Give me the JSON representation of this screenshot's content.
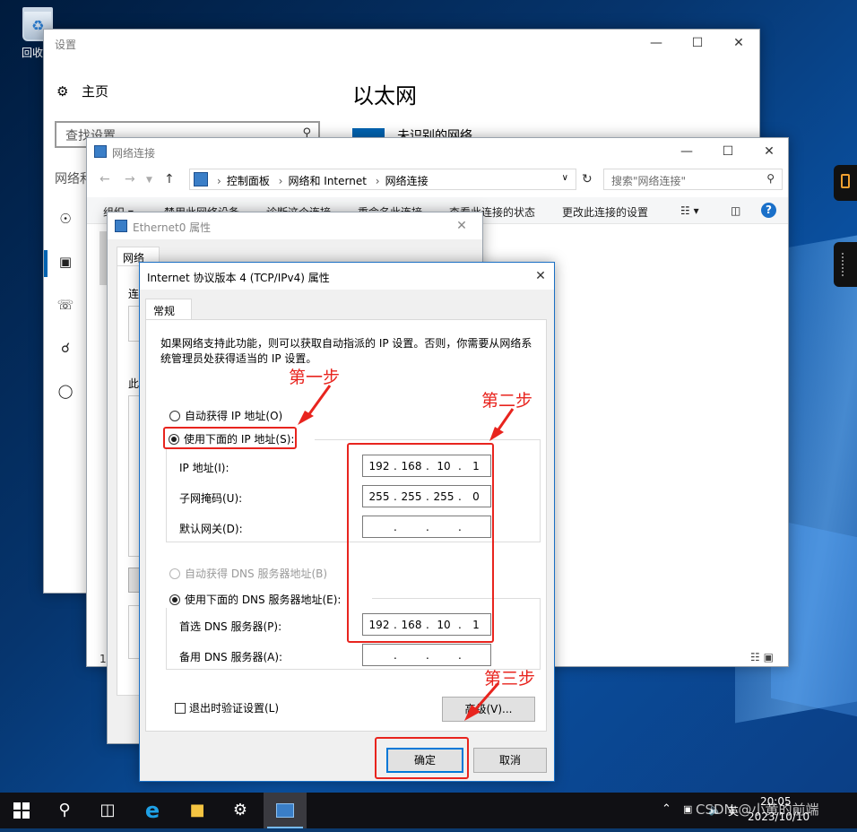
{
  "desktop": {
    "recycle_bin_label": "回收站"
  },
  "settings": {
    "title": "设置",
    "home_label": "主页",
    "search_placeholder": "查找设置",
    "section_label": "网络和",
    "page_title": "以太网",
    "ethernet_label": "未识别的网络"
  },
  "netconn": {
    "title": "网络连接",
    "breadcrumb": [
      "控制面板",
      "网络和 Internet",
      "网络连接"
    ],
    "search_placeholder": "搜索\"网络连接\"",
    "commands": [
      "组织 ▾",
      "禁用此网络设备",
      "诊断这个连接",
      "重命名此连接",
      "查看此连接的状态",
      "更改此连接的设置"
    ],
    "status_count": "1"
  },
  "ethprops": {
    "title": "Ethernet0 属性",
    "tab_label": "网络",
    "connect_label": "连",
    "items_label": "此"
  },
  "ipv4": {
    "title": "Internet 协议版本 4 (TCP/IPv4) 属性",
    "tab_label": "常规",
    "description": "如果网络支持此功能，则可以获取自动指派的 IP 设置。否则，你需要从网络系统管理员处获得适当的 IP 设置。",
    "auto_ip_label": "自动获得 IP 地址(O)",
    "manual_ip_label": "使用下面的 IP 地址(S):",
    "ip_label": "IP 地址(I):",
    "ip_value": [
      "192",
      "168",
      "10",
      "1"
    ],
    "subnet_label": "子网掩码(U):",
    "subnet_value": [
      "255",
      "255",
      "255",
      "0"
    ],
    "gateway_label": "默认网关(D):",
    "auto_dns_label": "自动获得 DNS 服务器地址(B)",
    "manual_dns_label": "使用下面的 DNS 服务器地址(E):",
    "pref_dns_label": "首选 DNS 服务器(P):",
    "pref_dns_value": [
      "192",
      "168",
      "10",
      "1"
    ],
    "alt_dns_label": "备用 DNS 服务器(A):",
    "validate_label": "退出时验证设置(L)",
    "advanced_label": "高级(V)...",
    "ok_label": "确定",
    "cancel_label": "取消"
  },
  "annotations": {
    "step1": "第一步",
    "step2": "第二步",
    "step3": "第三步",
    "color": "#e8241e"
  },
  "taskbar": {
    "time": "20:05",
    "date": "2023/10/10",
    "ime": "英",
    "watermark": "CSDN @小黄的前端"
  }
}
